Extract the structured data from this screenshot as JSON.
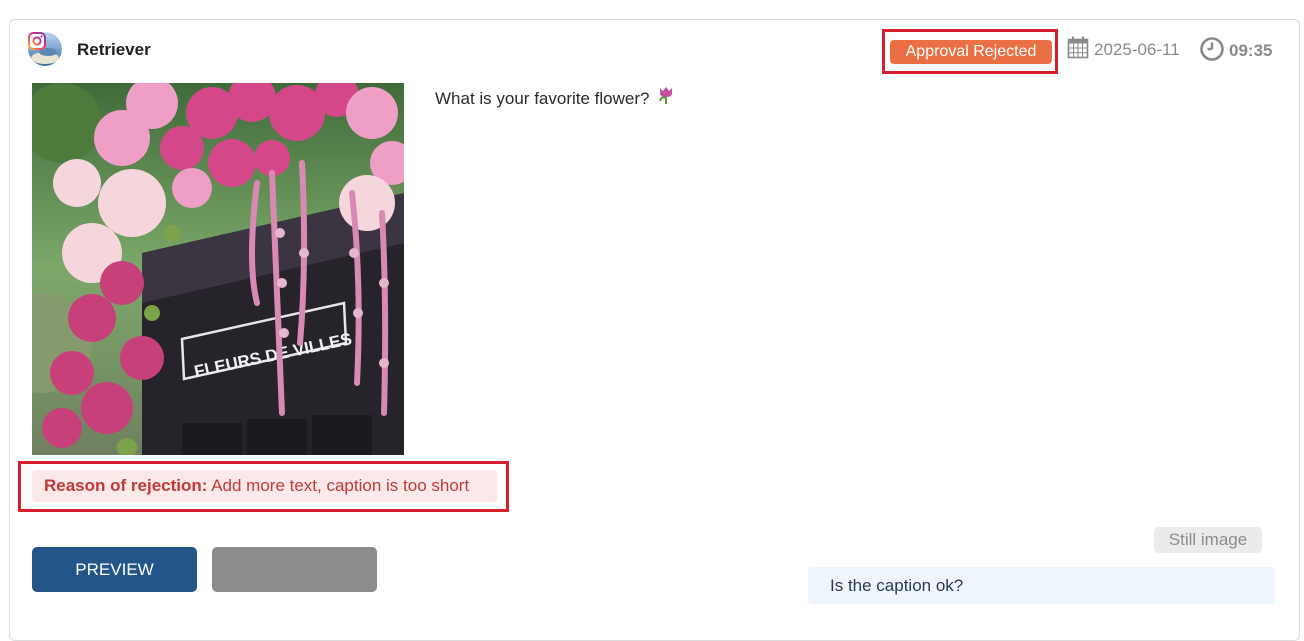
{
  "post": {
    "account_name": "Retriever",
    "platform_icon": "instagram-icon",
    "status_label": "Approval Rejected",
    "date": "2025-06-11",
    "time": "09:35",
    "caption": "What is your favorite flower?",
    "caption_emoji": "tulip-icon",
    "image_sign_text": "FLEURS DE VILLES",
    "rejection": {
      "label": "Reason of rejection:",
      "text": " Add more text, caption is too short"
    },
    "media_type": "Still image",
    "comment": "Is the caption ok?"
  },
  "actions": {
    "preview_label": "PREVIEW"
  },
  "colors": {
    "status_badge": "#ea6f44",
    "highlight_frame": "#d6202e",
    "preview_button": "#245589",
    "secondary_button": "#8c8c8c",
    "rejection_bg": "#fbe8e8",
    "rejection_text": "#c03a3a",
    "comment_bg": "#eef5fd"
  }
}
